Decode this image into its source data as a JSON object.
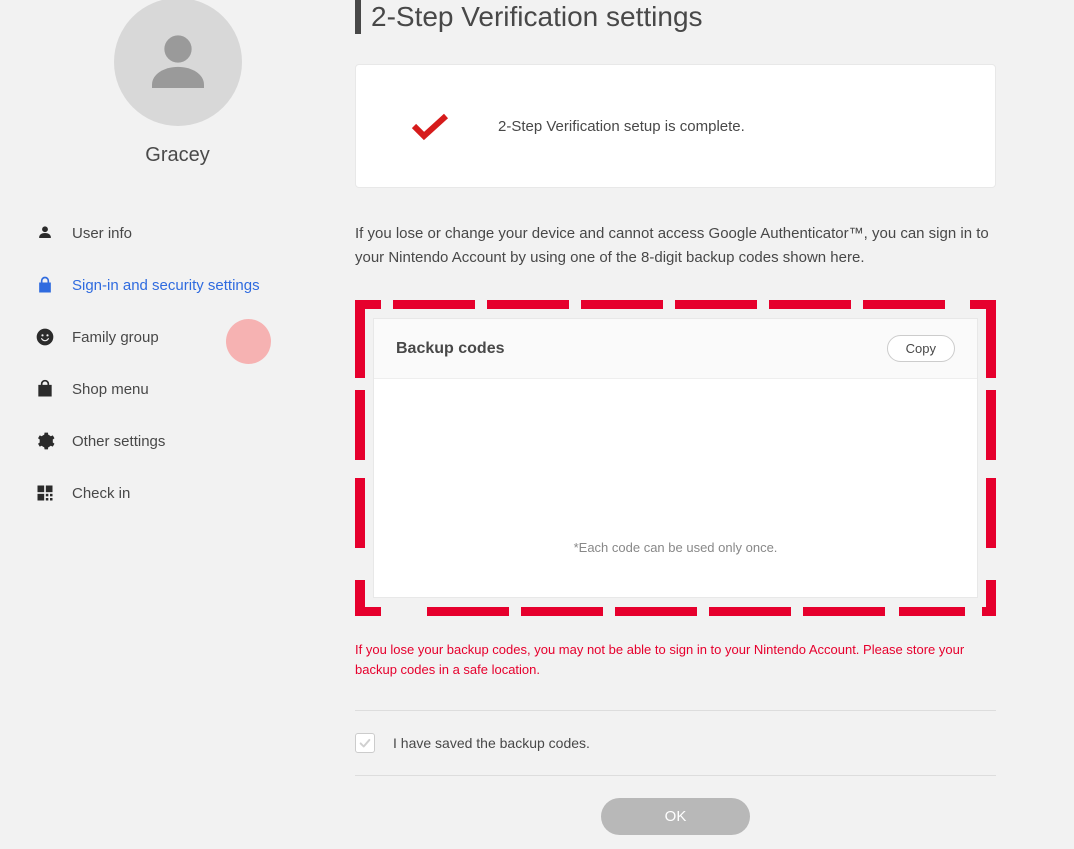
{
  "sidebar": {
    "username": "Gracey",
    "items": [
      {
        "label": "User info"
      },
      {
        "label": "Sign-in and security settings"
      },
      {
        "label": "Family group"
      },
      {
        "label": "Shop menu"
      },
      {
        "label": "Other settings"
      },
      {
        "label": "Check in"
      }
    ]
  },
  "main": {
    "title": "2-Step Verification settings",
    "status_text": "2-Step Verification setup is complete.",
    "info_text": "If you lose or change your device and cannot access Google Authenticator™, you can sign in to your Nintendo Account by using one of the 8-digit backup codes shown here.",
    "backup": {
      "title": "Backup codes",
      "copy_label": "Copy",
      "note": "*Each code can be used only once."
    },
    "warning": "If you lose your backup codes, you may not be able to sign in to your Nintendo Account. Please store your backup codes in a safe location.",
    "checkbox_label": "I have saved the backup codes.",
    "ok_label": "OK"
  }
}
